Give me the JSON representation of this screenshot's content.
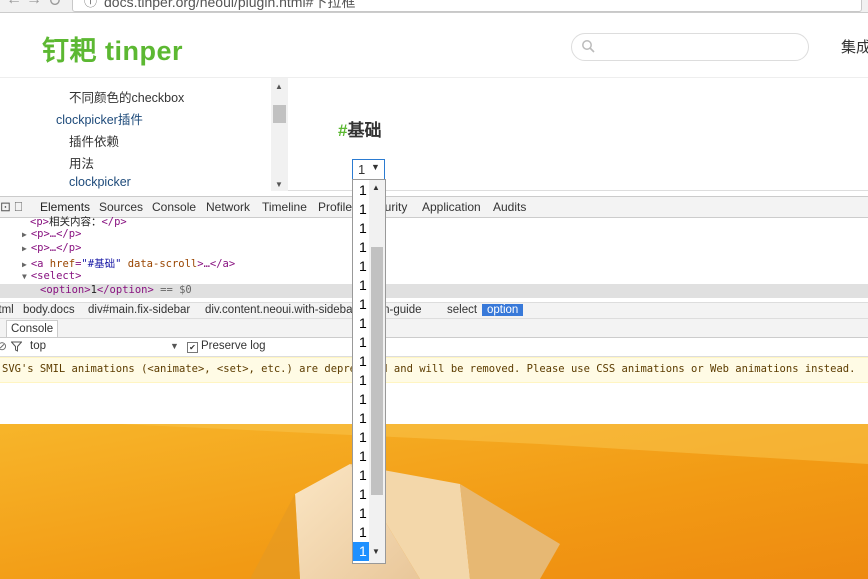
{
  "browser": {
    "url": "docs.tinper.org/neoui/plugin.html#下拉框"
  },
  "header": {
    "logo": "钉耙 tinper",
    "nav_link": "集成"
  },
  "sidebar": {
    "items": [
      {
        "label": "不同颜色的checkbox",
        "level": 3
      },
      {
        "label": "clockpicker插件",
        "level": 2
      },
      {
        "label": "插件依赖",
        "level": 3
      },
      {
        "label": "用法",
        "level": 3
      },
      {
        "label": "clockpicker",
        "level": 3
      }
    ]
  },
  "content": {
    "heading_hash": "#",
    "heading": "基础",
    "select_value": "1"
  },
  "devtools": {
    "tabs": [
      "Elements",
      "Sources",
      "Console",
      "Network",
      "Timeline",
      "Profiles",
      "Security",
      "Application",
      "Audits"
    ],
    "code_lines": {
      "l0_text": "相关内容：",
      "l1": "<p>…</p>",
      "l2": "<p>…</p>",
      "l3_href": "\"#基础\"",
      "l3_attr": "data-scroll",
      "l4": "<select>",
      "l5_value": "1",
      "l5_suffix": "== $0"
    },
    "breadcrumbs": [
      "html",
      "body.docs",
      "div#main.fix-sidebar",
      "div.content.neoui.with-sidebar.plugin-guide",
      "select",
      "option"
    ],
    "console_tab": "Console",
    "filter_context": "top",
    "preserve_log": "Preserve log",
    "preserve_log_checked": true,
    "warning": "SVG's SMIL animations (<animate>, <set>, etc.) are deprecated and will be removed. Please use CSS animations or Web animations instead."
  },
  "dropdown": {
    "options": [
      "1",
      "1",
      "1",
      "1",
      "1",
      "1",
      "1",
      "1",
      "1",
      "1",
      "1",
      "1",
      "1",
      "1",
      "1",
      "1",
      "1",
      "1",
      "1",
      "1"
    ],
    "selected_index": 19
  },
  "colors": {
    "brand_green": "#5cb832",
    "selection_blue": "#1e90ff",
    "wallpaper_orange": "#f4a51c"
  }
}
